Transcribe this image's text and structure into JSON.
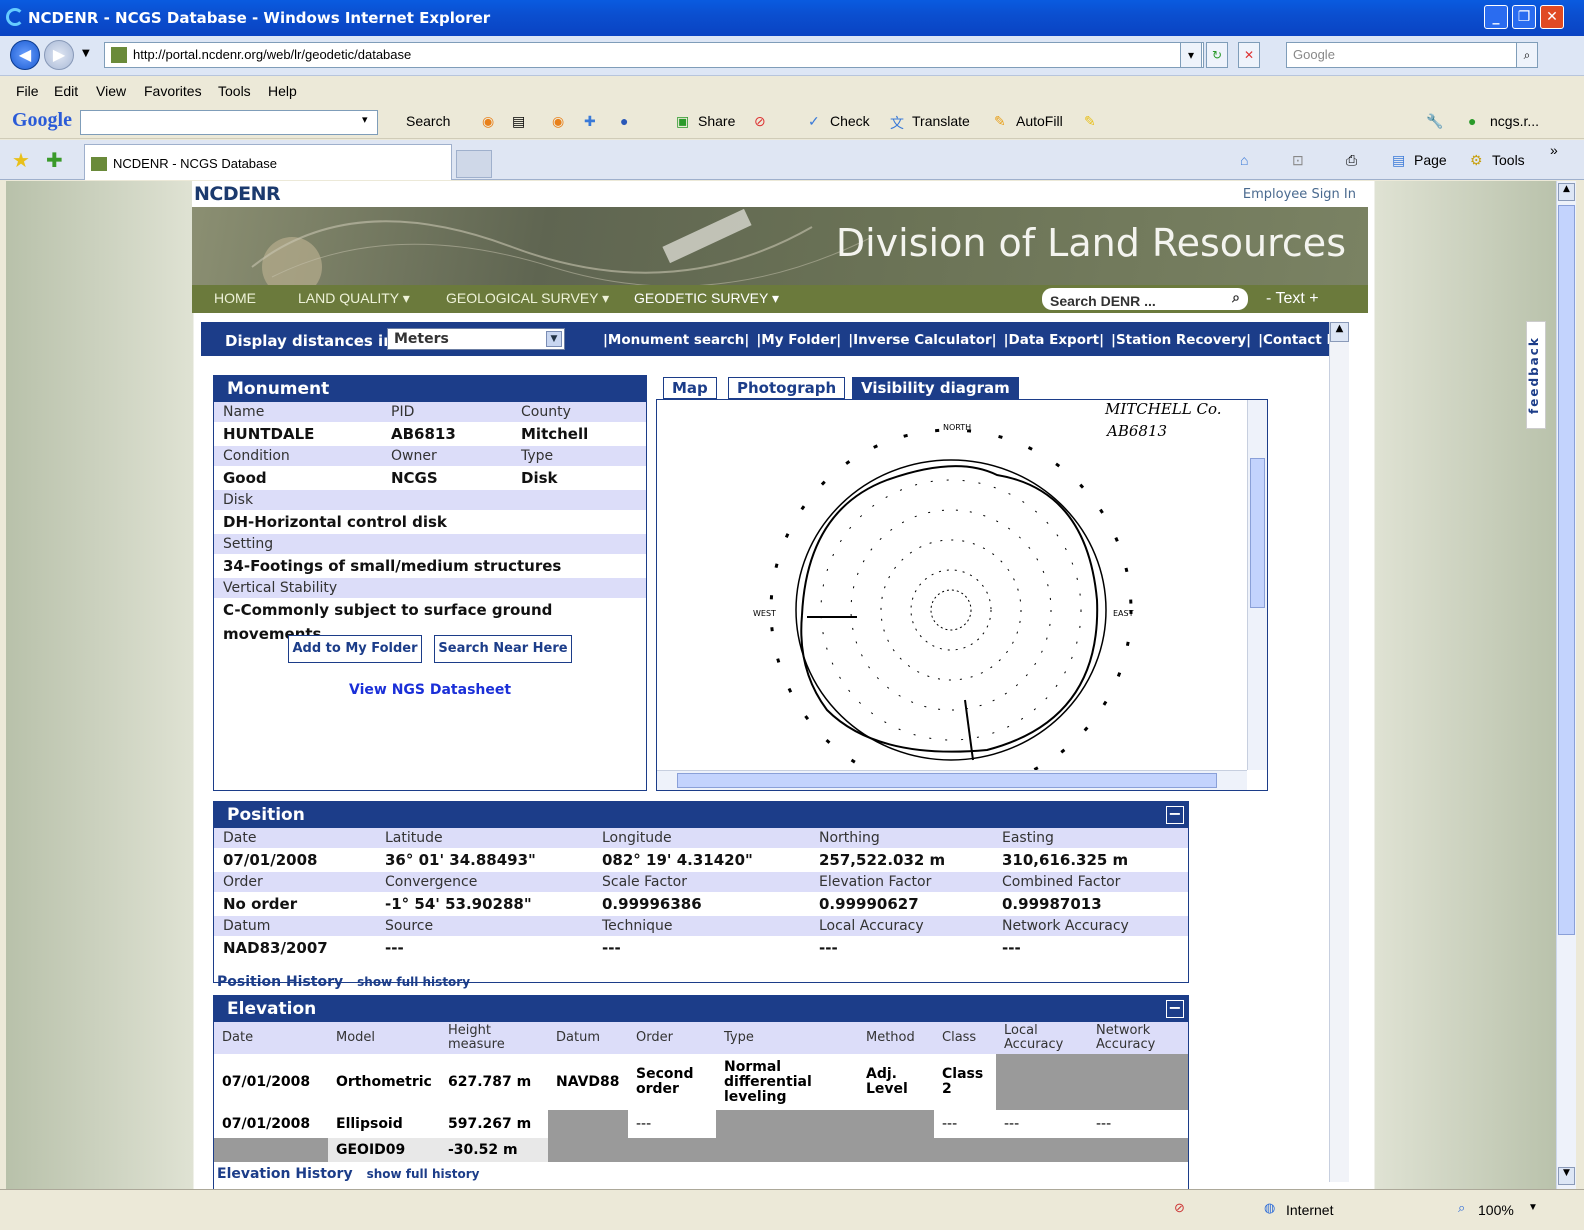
{
  "window": {
    "title": "NCDENR - NCGS Database - Windows Internet Explorer"
  },
  "address": {
    "url": "http://portal.ncdenr.org/web/lr/geodetic/database",
    "search_placeholder": "Google"
  },
  "menu": [
    "File",
    "Edit",
    "View",
    "Favorites",
    "Tools",
    "Help"
  ],
  "gtoolbar": {
    "logo": "Google",
    "items": [
      "Search",
      "Share",
      "Check",
      "Translate",
      "AutoFill"
    ],
    "right": "ncgs.r..."
  },
  "tabs": {
    "active": "NCDENR - NCGS Database",
    "right_items": [
      "Page",
      "Tools"
    ]
  },
  "header": {
    "logo": "NCDENR",
    "employee": "Employee Sign In",
    "banner_title": "Division of Land Resources"
  },
  "mainnav": {
    "items": [
      "HOME",
      "LAND QUALITY ▾",
      "GEOLOGICAL SURVEY ▾",
      "GEODETIC SURVEY ▾"
    ],
    "search_placeholder": "Search DENR ...",
    "text_size": "- Text +"
  },
  "utility": {
    "label": "Display distances in",
    "unit": "Meters",
    "links": [
      "|Monument search|",
      "|My Folder|",
      "|Inverse Calculator|",
      "|Data Export|",
      "|Station Recovery|",
      "|Contact NCGS|"
    ]
  },
  "feedback": "feedback",
  "monument": {
    "title": "Monument",
    "name_label": "Name",
    "pid_label": "PID",
    "county_label": "County",
    "name": "HUNTDALE",
    "pid": "AB6813",
    "county": "Mitchell",
    "condition_label": "Condition",
    "owner_label": "Owner",
    "type_label": "Type",
    "condition": "Good",
    "owner": "NCGS",
    "type": "Disk",
    "disk_label": "Disk",
    "disk": "DH-Horizontal control disk",
    "setting_label": "Setting",
    "setting": "34-Footings of small/medium structures",
    "stability_label": "Vertical Stability",
    "stability": "C-Commonly subject to surface ground movements.",
    "add_button": "Add to My Folder",
    "near_button": "Search Near Here",
    "datasheet_link": "View NGS Datasheet"
  },
  "view_tabs": {
    "map": "Map",
    "photo": "Photograph",
    "visibility": "Visibility diagram"
  },
  "diagram": {
    "note1": "MITCHELL Co.",
    "note2": "AB6813",
    "north": "NORTH",
    "west": "WEST",
    "east": "EAST"
  },
  "position": {
    "title": "Position",
    "labels1": [
      "Date",
      "Latitude",
      "Longitude",
      "Northing",
      "Easting"
    ],
    "values1": [
      "07/01/2008",
      "36° 01' 34.88493\"",
      "082° 19' 4.31420\"",
      "257,522.032 m",
      "310,616.325 m"
    ],
    "labels2": [
      "Order",
      "Convergence",
      "Scale Factor",
      "Elevation Factor",
      "Combined Factor"
    ],
    "values2": [
      "No order",
      "-1° 54' 53.90288\"",
      "0.99996386",
      "0.99990627",
      "0.99987013"
    ],
    "labels3": [
      "Datum",
      "Source",
      "Technique",
      "Local Accuracy",
      "Network Accuracy"
    ],
    "values3": [
      "NAD83/2007",
      "---",
      "---",
      "---",
      "---"
    ],
    "history": "Position History",
    "full": "show full history"
  },
  "elevation": {
    "title": "Elevation",
    "headers": [
      "Date",
      "Model",
      "Height measure",
      "Datum",
      "Order",
      "Type",
      "Method",
      "Class",
      "Local Accuracy",
      "Network Accuracy"
    ],
    "row1": [
      "07/01/2008",
      "Orthometric",
      "627.787 m",
      "NAVD88",
      "Second order",
      "Normal differential leveling",
      "Adj. Level",
      "Class 2"
    ],
    "row2": [
      "07/01/2008",
      "Ellipsoid",
      "597.267 m",
      "---",
      "---",
      "---",
      "---"
    ],
    "row3": [
      "GEOID09",
      "-30.52 m"
    ],
    "history": "Elevation History",
    "full": "show full history"
  },
  "status": {
    "zone": "Internet",
    "zoom": "100%"
  }
}
